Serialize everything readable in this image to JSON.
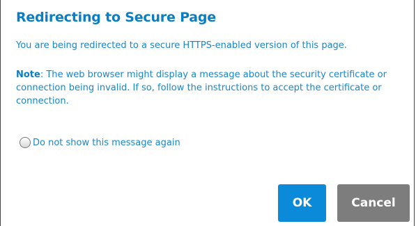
{
  "dialog": {
    "title": "Redirecting to Secure Page",
    "message": "You are being redirected to a secure HTTPS-enabled version of this page.",
    "note_label": "Note",
    "note_text": ": The web browser might display a message about the security certificate or connection being invalid. If so, follow the instructions to accept the certificate or connection.",
    "checkbox_label": "Do not show this message again",
    "checkbox_checked": false,
    "ok_label": "OK",
    "cancel_label": "Cancel"
  },
  "colors": {
    "accent": "#0a8ad8",
    "text": "#1a86c8",
    "cancel_button": "#7d7d7d"
  }
}
